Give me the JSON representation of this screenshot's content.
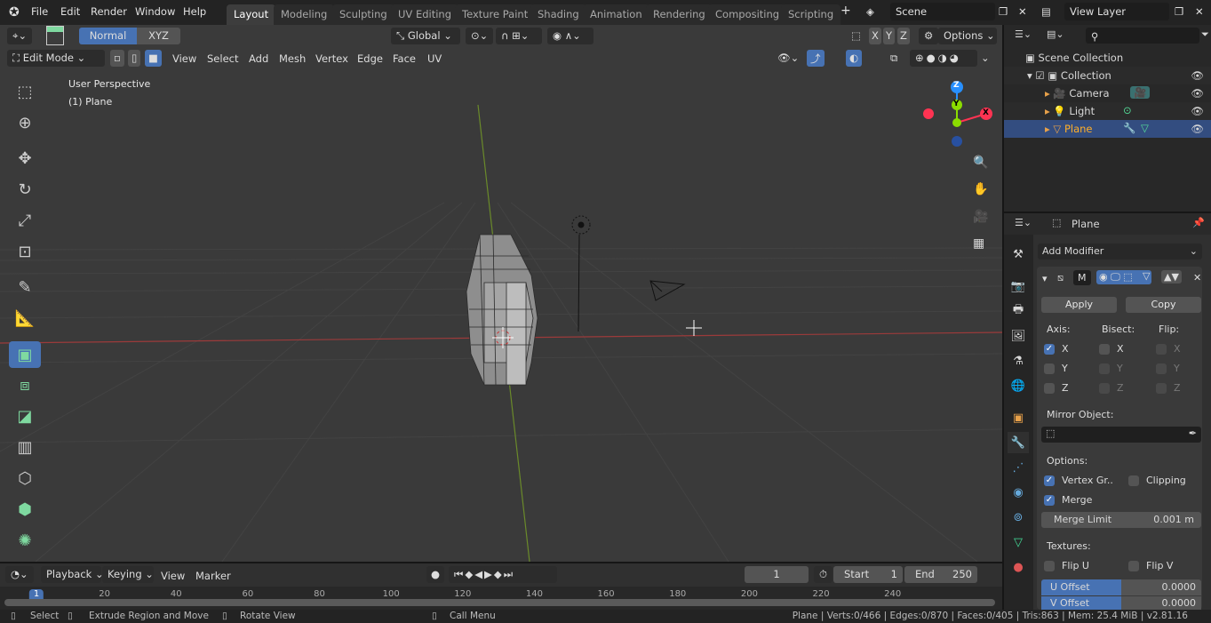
{
  "topbar": {
    "menus": [
      "File",
      "Edit",
      "Render",
      "Window",
      "Help"
    ],
    "workspaces": [
      "Layout",
      "Modeling",
      "Sculpting",
      "UV Editing",
      "Texture Paint",
      "Shading",
      "Animation",
      "Rendering",
      "Compositing",
      "Scripting"
    ],
    "active_workspace": "Layout",
    "scene": "Scene",
    "view_layer": "View Layer"
  },
  "viewport": {
    "orientation_normal": "Normal",
    "orientation_xyz": "XYZ",
    "transform_orientation": "Global",
    "options": "Options",
    "mode": "Edit Mode",
    "menus": [
      "View",
      "Select",
      "Add",
      "Mesh",
      "Vertex",
      "Edge",
      "Face",
      "UV"
    ],
    "overlay_text": "User Perspective",
    "object_text": "(1) Plane",
    "gizmo": {
      "x": "X",
      "y": "Y",
      "z": "Z"
    },
    "axis_lock": [
      "X",
      "Y",
      "Z"
    ]
  },
  "outliner": {
    "search_placeholder": "",
    "root": "Scene Collection",
    "collection": "Collection",
    "items": [
      {
        "name": "Camera",
        "icon": "camera-icon"
      },
      {
        "name": "Light",
        "icon": "light-icon"
      },
      {
        "name": "Plane",
        "icon": "mesh-icon",
        "selected": true
      }
    ]
  },
  "properties": {
    "object": "Plane",
    "add_modifier": "Add Modifier",
    "modifier_name": "M",
    "apply": "Apply",
    "copy": "Copy",
    "axis_label": "Axis:",
    "bisect_label": "Bisect:",
    "flip_label": "Flip:",
    "axis": {
      "X": true,
      "Y": false,
      "Z": false
    },
    "bisect": {
      "X": false,
      "Y": false,
      "Z": false
    },
    "flip": {
      "X": false,
      "Y": false,
      "Z": false
    },
    "mirror_object_label": "Mirror Object:",
    "options_label": "Options:",
    "vertex_groups": "Vertex Gr..",
    "vertex_groups_checked": true,
    "clipping": "Clipping",
    "clipping_checked": false,
    "merge": "Merge",
    "merge_checked": true,
    "merge_limit_label": "Merge Limit",
    "merge_limit": "0.001 m",
    "textures_label": "Textures:",
    "flip_u": "Flip U",
    "flip_v": "Flip V",
    "u_offset_label": "U Offset",
    "u_offset": "0.0000",
    "v_offset_label": "V Offset",
    "v_offset": "0.0000"
  },
  "timeline": {
    "menus": [
      "Playback",
      "Keying",
      "View",
      "Marker"
    ],
    "current_frame": "1",
    "start_label": "Start",
    "start": "1",
    "end_label": "End",
    "end": "250",
    "ticks": [
      "1",
      "20",
      "40",
      "60",
      "80",
      "100",
      "120",
      "140",
      "160",
      "180",
      "200",
      "220",
      "240"
    ]
  },
  "status": {
    "select": "Select",
    "extrude": "Extrude Region and Move",
    "rotate": "Rotate View",
    "call_menu": "Call Menu",
    "stats": "Plane | Verts:0/466 | Edges:0/870 | Faces:0/405 | Tris:863 | Mem: 25.4 MiB | v2.81.16"
  },
  "colors": {
    "accent": "#4772b3",
    "x_axis": "#ff3352",
    "y_axis": "#8bdc00",
    "z_axis": "#2890ff",
    "selected_text": "#ffaf29"
  }
}
